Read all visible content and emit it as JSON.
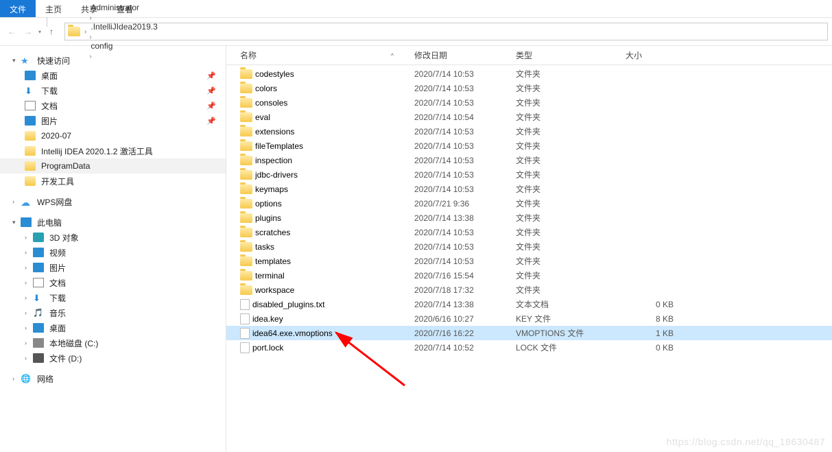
{
  "ribbon": {
    "tabs": [
      "文件",
      "主页",
      "共享",
      "查看"
    ],
    "active": 0
  },
  "breadcrumb": [
    "Administrator",
    ".IntelliJIdea2019.3",
    "config"
  ],
  "sidebar": {
    "quick_access": "快速访问",
    "desktop": "桌面",
    "downloads": "下载",
    "documents": "文档",
    "pictures": "图片",
    "folder_202007": "2020-07",
    "folder_idea": "Intellij IDEA 2020.1.2 激活工具",
    "folder_pd": "ProgramData",
    "folder_devtools": "开发工具",
    "wps": "WPS网盘",
    "this_pc": "此电脑",
    "objects3d": "3D 对象",
    "videos": "视频",
    "pictures2": "图片",
    "documents2": "文档",
    "downloads2": "下载",
    "music": "音乐",
    "desktop2": "桌面",
    "localdisk_c": "本地磁盘 (C:)",
    "file_d": "文件 (D:)",
    "network": "网络"
  },
  "columns": {
    "name": "名称",
    "date": "修改日期",
    "type": "类型",
    "size": "大小"
  },
  "rows": [
    {
      "icon": "folder",
      "name": "codestyles",
      "date": "2020/7/14 10:53",
      "type": "文件夹",
      "size": ""
    },
    {
      "icon": "folder",
      "name": "colors",
      "date": "2020/7/14 10:53",
      "type": "文件夹",
      "size": ""
    },
    {
      "icon": "folder",
      "name": "consoles",
      "date": "2020/7/14 10:53",
      "type": "文件夹",
      "size": ""
    },
    {
      "icon": "folder",
      "name": "eval",
      "date": "2020/7/14 10:54",
      "type": "文件夹",
      "size": ""
    },
    {
      "icon": "folder",
      "name": "extensions",
      "date": "2020/7/14 10:53",
      "type": "文件夹",
      "size": ""
    },
    {
      "icon": "folder",
      "name": "fileTemplates",
      "date": "2020/7/14 10:53",
      "type": "文件夹",
      "size": ""
    },
    {
      "icon": "folder",
      "name": "inspection",
      "date": "2020/7/14 10:53",
      "type": "文件夹",
      "size": ""
    },
    {
      "icon": "folder",
      "name": "jdbc-drivers",
      "date": "2020/7/14 10:53",
      "type": "文件夹",
      "size": ""
    },
    {
      "icon": "folder",
      "name": "keymaps",
      "date": "2020/7/14 10:53",
      "type": "文件夹",
      "size": ""
    },
    {
      "icon": "folder",
      "name": "options",
      "date": "2020/7/21 9:36",
      "type": "文件夹",
      "size": ""
    },
    {
      "icon": "folder",
      "name": "plugins",
      "date": "2020/7/14 13:38",
      "type": "文件夹",
      "size": ""
    },
    {
      "icon": "folder",
      "name": "scratches",
      "date": "2020/7/14 10:53",
      "type": "文件夹",
      "size": ""
    },
    {
      "icon": "folder",
      "name": "tasks",
      "date": "2020/7/14 10:53",
      "type": "文件夹",
      "size": ""
    },
    {
      "icon": "folder",
      "name": "templates",
      "date": "2020/7/14 10:53",
      "type": "文件夹",
      "size": ""
    },
    {
      "icon": "folder",
      "name": "terminal",
      "date": "2020/7/16 15:54",
      "type": "文件夹",
      "size": ""
    },
    {
      "icon": "folder",
      "name": "workspace",
      "date": "2020/7/18 17:32",
      "type": "文件夹",
      "size": ""
    },
    {
      "icon": "file",
      "name": "disabled_plugins.txt",
      "date": "2020/7/14 13:38",
      "type": "文本文档",
      "size": "0 KB"
    },
    {
      "icon": "file",
      "name": "idea.key",
      "date": "2020/6/16 10:27",
      "type": "KEY 文件",
      "size": "8 KB"
    },
    {
      "icon": "file",
      "name": "idea64.exe.vmoptions",
      "date": "2020/7/16 16:22",
      "type": "VMOPTIONS 文件",
      "size": "1 KB",
      "selected": true
    },
    {
      "icon": "file",
      "name": "port.lock",
      "date": "2020/7/14 10:52",
      "type": "LOCK 文件",
      "size": "0 KB"
    }
  ],
  "watermark": "https://blog.csdn.net/qq_18630487"
}
